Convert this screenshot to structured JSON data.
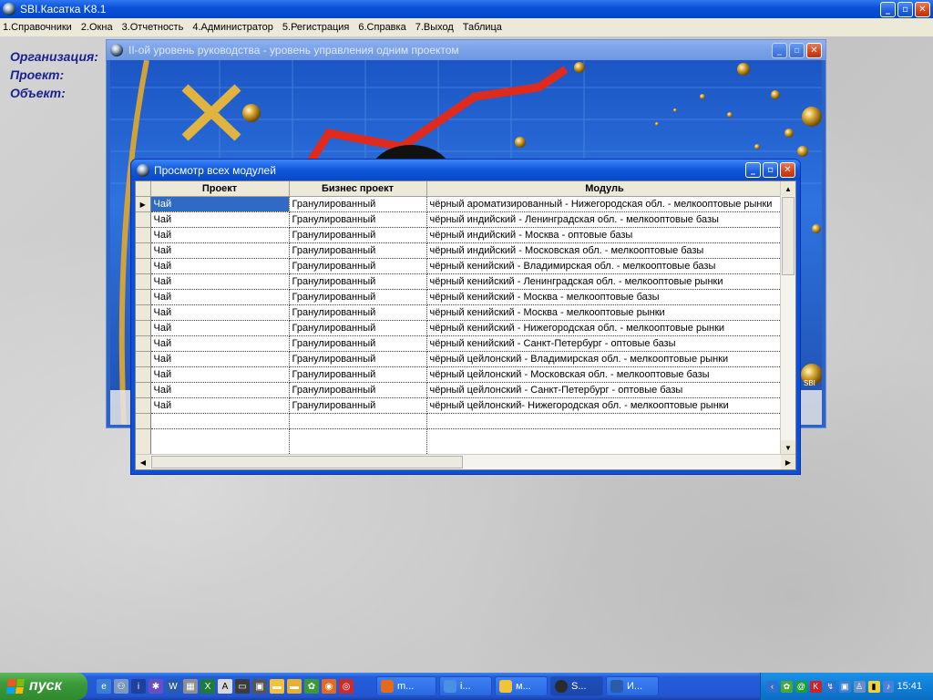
{
  "app": {
    "title": "SBI.Касатка K8.1",
    "menu": [
      "1.Справочники",
      "2.Окна",
      "3.Отчетность",
      "4.Администратор",
      "5.Регистрация",
      "6.Справка",
      "7.Выход",
      "Таблица"
    ]
  },
  "left_labels": [
    "Организация:",
    "Проект:",
    "Объект:"
  ],
  "background_window": {
    "title": "II-ой уровень руководства - уровень управления одним проектом",
    "watermark": "SBI"
  },
  "modules_window": {
    "title": "Просмотр всех модулей",
    "columns": [
      "Проект",
      "Бизнес проект",
      "Модуль"
    ],
    "rows": [
      [
        "Чай",
        "Гранулированный",
        "чёрный ароматизированный - Нижегородская обл. - мелкооптовые рынки"
      ],
      [
        "Чай",
        "Гранулированный",
        "чёрный индийский - Ленинградская обл. - мелкооптовые базы"
      ],
      [
        "Чай",
        "Гранулированный",
        "чёрный индийский - Москва - оптовые базы"
      ],
      [
        "Чай",
        "Гранулированный",
        "чёрный индийский - Московская обл. - мелкооптовые базы"
      ],
      [
        "Чай",
        "Гранулированный",
        "чёрный кенийский - Владимирская обл. - мелкооптовые базы"
      ],
      [
        "Чай",
        "Гранулированный",
        "чёрный кенийский - Ленинградская обл. - мелкооптовые рынки"
      ],
      [
        "Чай",
        "Гранулированный",
        "чёрный кенийский - Москва - мелкооптовые базы"
      ],
      [
        "Чай",
        "Гранулированный",
        "чёрный кенийский - Москва - мелкооптовые рынки"
      ],
      [
        "Чай",
        "Гранулированный",
        "чёрный кенийский - Нижегородская обл. - мелкооптовые рынки"
      ],
      [
        "Чай",
        "Гранулированный",
        "чёрный кенийский - Санкт-Петербург - оптовые базы"
      ],
      [
        "Чай",
        "Гранулированный",
        "чёрный цейлонский - Владимирская обл. - мелкооптовые рынки"
      ],
      [
        "Чай",
        "Гранулированный",
        "чёрный цейлонский - Московская обл. - мелкооптовые базы"
      ],
      [
        "Чай",
        "Гранулированный",
        "чёрный цейлонский - Санкт-Петербург - оптовые базы"
      ],
      [
        "Чай",
        "Гранулированный",
        "чёрный цейлонский- Нижегородская обл. - мелкооптовые рынки"
      ]
    ],
    "selected_row": 0
  },
  "taskbar": {
    "start_label": "пуск",
    "quick_launch_icons": [
      "ie-icon",
      "network-icon",
      "info-icon",
      "gear-icon",
      "word-icon",
      "calc-icon",
      "excel-icon",
      "font-icon",
      "screen-icon",
      "ico-icon",
      "folder-icon",
      "folder-icon",
      "flower-icon",
      "firefox-icon",
      "opera-icon"
    ],
    "tasks": [
      {
        "label": "m...",
        "icon": "firefox-icon",
        "active": false,
        "color": "#e56a1c"
      },
      {
        "label": "i...",
        "icon": "ie-icon",
        "active": false,
        "color": "#4a90e2"
      },
      {
        "label": "м...",
        "icon": "folder-icon",
        "active": false,
        "color": "#f2c23a"
      },
      {
        "label": "S...",
        "icon": "sbi-icon",
        "active": true,
        "color": "#2b2b2b"
      },
      {
        "label": "И...",
        "icon": "word-icon",
        "active": false,
        "color": "#2a5caa"
      }
    ],
    "clock": "15:41"
  }
}
